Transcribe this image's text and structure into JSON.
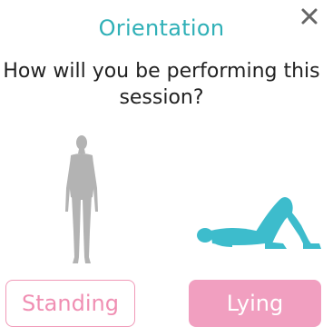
{
  "dialog": {
    "title": "Orientation",
    "question": "How will you be performing this session?"
  },
  "options": {
    "standing": {
      "label": "Standing",
      "selected": false
    },
    "lying": {
      "label": "Lying",
      "selected": true
    }
  },
  "colors": {
    "title": "#2fb0b7",
    "accent_pink": "#f19fc0",
    "figure_teal": "#3dbccc",
    "figure_grey": "#b3b3b3"
  },
  "icons": {
    "close": "close-icon",
    "standing_figure": "standing-person-icon",
    "lying_figure": "lying-person-icon"
  }
}
